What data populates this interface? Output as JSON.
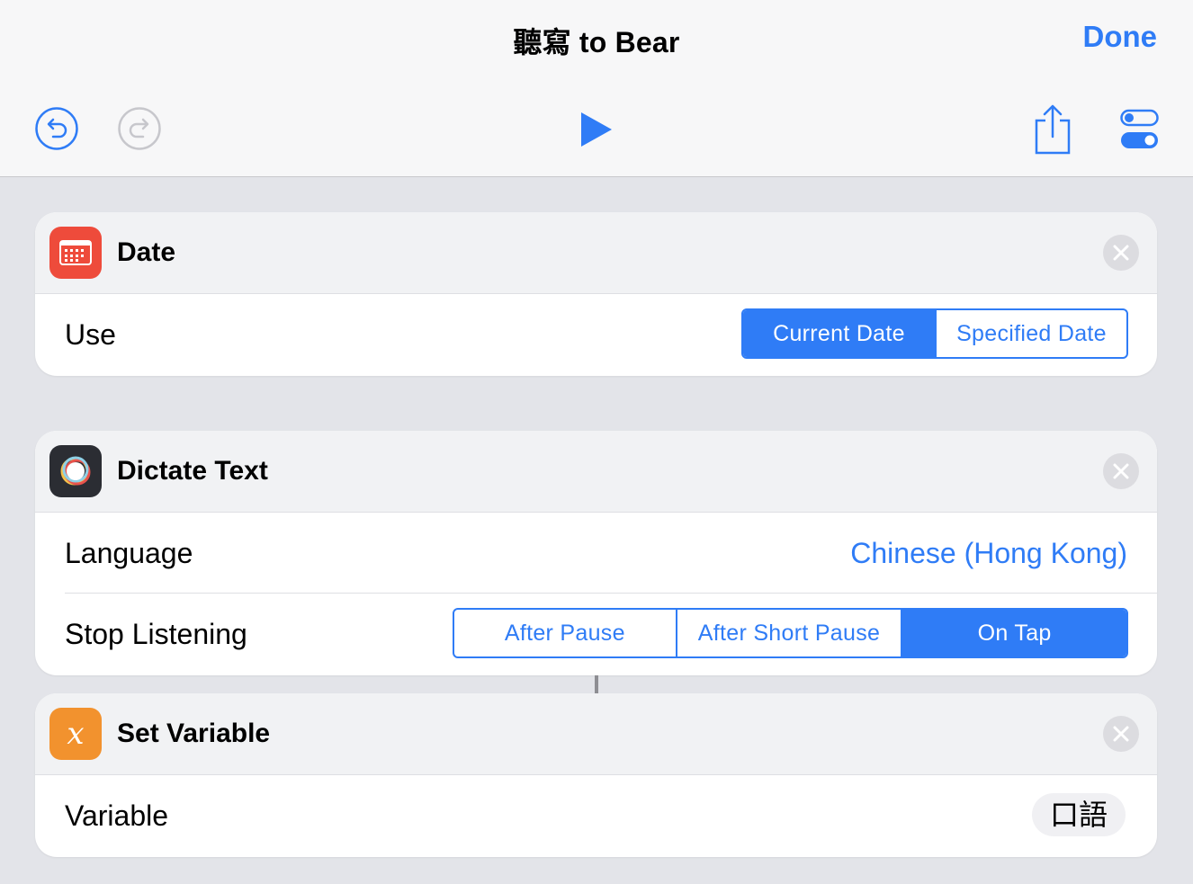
{
  "header": {
    "title": "聽寫 to Bear",
    "done_label": "Done",
    "icons": [
      "undo-icon",
      "redo-icon",
      "play-icon",
      "share-icon",
      "settings-toggle-icon"
    ]
  },
  "colors": {
    "accent": "#2f7cf6",
    "date_icon": "#ee4b3b",
    "variable_icon": "#f2922e",
    "dictate_icon": "#2b2d33"
  },
  "actions": [
    {
      "title": "Date",
      "icon": "calendar-icon",
      "use_label": "Use",
      "use_options": [
        "Current Date",
        "Specified Date"
      ],
      "use_selected": "Current Date"
    },
    {
      "title": "Dictate Text",
      "icon": "dictation-icon",
      "language_label": "Language",
      "language_value": "Chinese (Hong Kong)",
      "stop_label": "Stop Listening",
      "stop_options": [
        "After Pause",
        "After Short Pause",
        "On Tap"
      ],
      "stop_selected": "On Tap"
    },
    {
      "title": "Set Variable",
      "icon": "variable-icon",
      "variable_label": "Variable",
      "variable_value": "口語"
    }
  ]
}
